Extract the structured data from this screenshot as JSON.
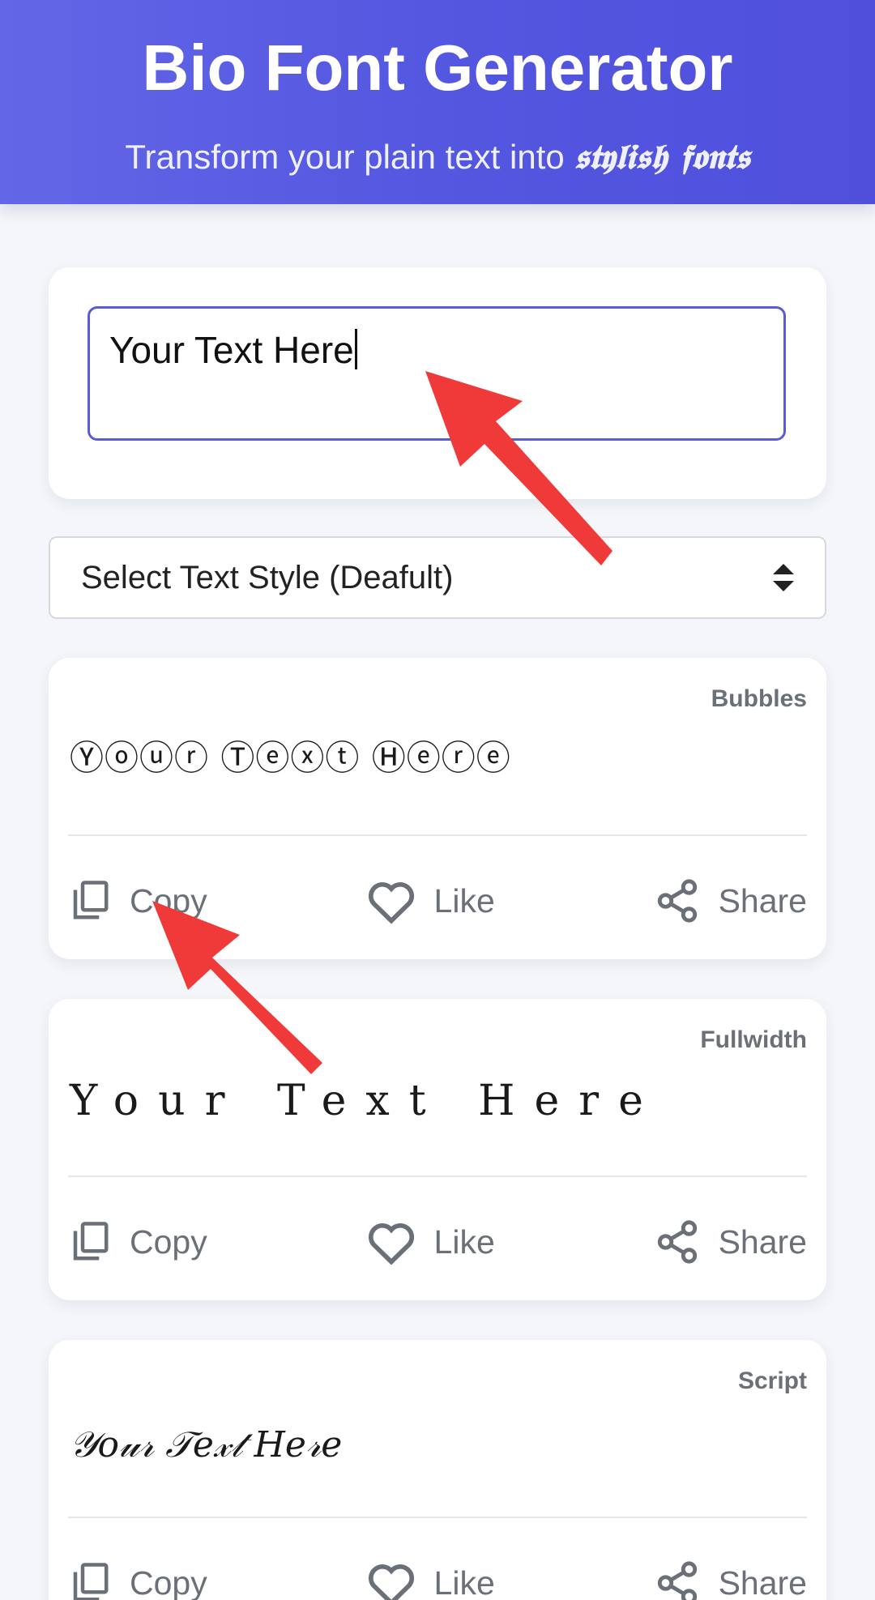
{
  "header": {
    "title": "Bio Font Generator",
    "subtitle_plain": "Transform your plain text into",
    "subtitle_styled": "𝖘𝖙𝖞𝖑𝖎𝖘𝖍 𝖋𝖔𝖓𝖙𝖘"
  },
  "input": {
    "value": "Your Text Here"
  },
  "select": {
    "selected": "Select Text Style (Deafult)"
  },
  "actions": {
    "copy": "Copy",
    "like": "Like",
    "share": "Share"
  },
  "cards": [
    {
      "style": "Bubbles",
      "preview": "Ⓨⓞⓤⓡ Ⓣⓔⓧⓣ Ⓗⓔⓡⓔ"
    },
    {
      "style": "Fullwidth",
      "preview": "Your Text Here"
    },
    {
      "style": "Script",
      "preview": "𝒴𝑜𝓊𝓇 𝒯𝑒𝓍𝓉 𝐻𝑒𝓇𝑒"
    }
  ],
  "colors": {
    "header_gradient_start": "#6366e6",
    "header_gradient_end": "#4f4fdc",
    "input_border": "#5b5bd6",
    "annotation_arrow": "#f03a3a"
  },
  "icons": [
    "copy-icon",
    "heart-icon",
    "share-icon",
    "select-updown-icon",
    "annotation-arrow"
  ]
}
